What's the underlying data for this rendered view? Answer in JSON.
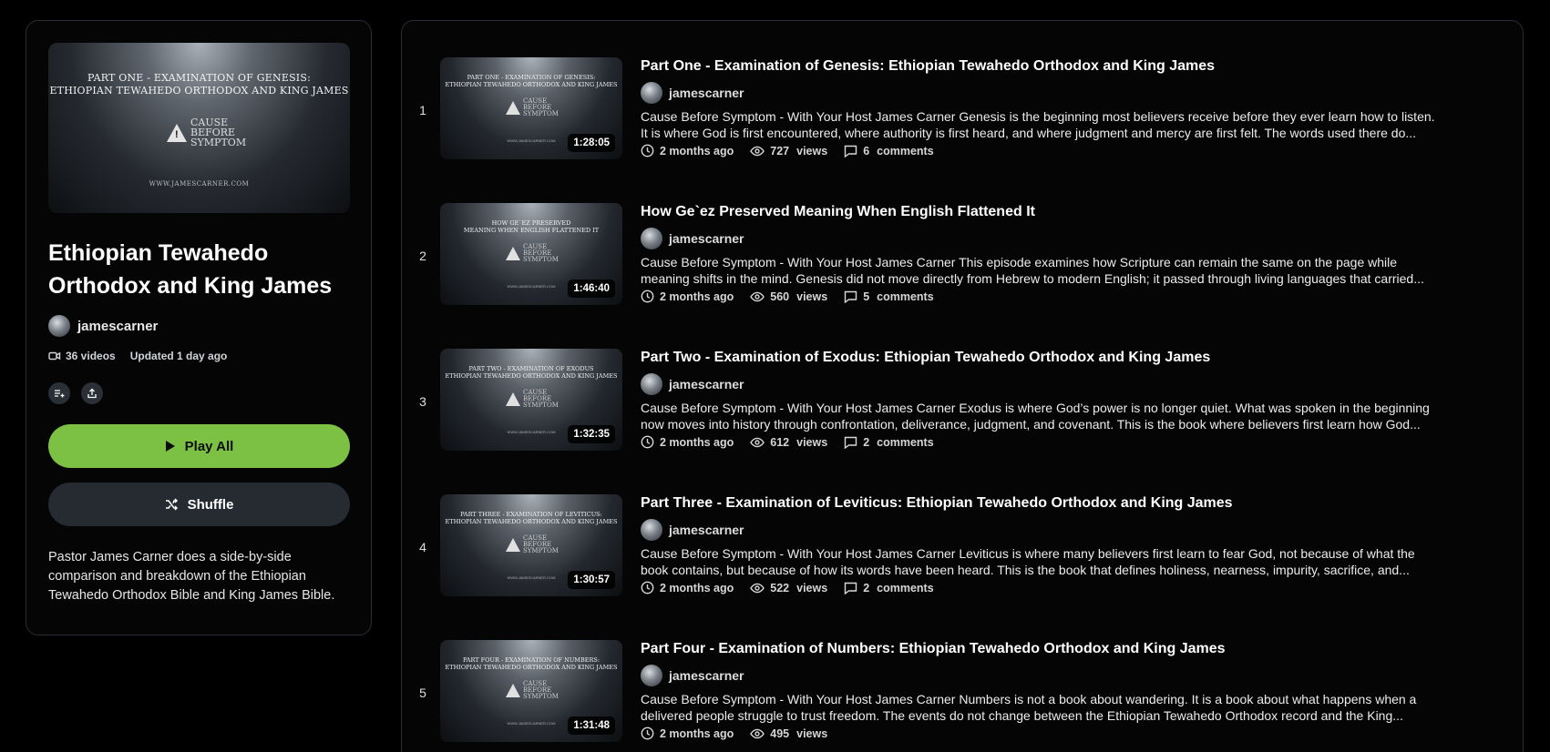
{
  "playlist": {
    "cover": {
      "line1": "PART ONE - EXAMINATION OF GENESIS:",
      "line2": "ETHIOPIAN TEWAHEDO ORTHODOX AND KING JAMES",
      "brand1": "CAUSE",
      "brand2": "BEFORE",
      "brand3": "SYMPTOM",
      "site": "WWW.JAMESCARNER.COM"
    },
    "title_line1": "Ethiopian Tewahedo",
    "title_line2": "Orthodox and King James",
    "owner": "jamescarner",
    "video_count": "36 videos",
    "updated": "Updated 1 day ago",
    "play_all": "Play All",
    "shuffle": "Shuffle",
    "description": "Pastor James Carner does a side-by-side comparison and breakdown of the Ethiopian Tewahedo Orthodox Bible and King James Bible.",
    "icons": [
      "add-to-queue-icon",
      "share-icon"
    ],
    "accent": "#7cc143"
  },
  "videos": [
    {
      "index": "1",
      "thumb_line1": "PART ONE - EXAMINATION OF GENESIS:",
      "thumb_line2": "ETHIOPIAN TEWAHEDO ORTHODOX AND KING JAMES",
      "duration": "1:28:05",
      "title": "Part One - Examination of Genesis: Ethiopian Tewahedo Orthodox and King James",
      "channel": "jamescarner",
      "desc_line1": "Cause Before Symptom - With Your Host James Carner Genesis is the beginning most believers receive before they ever learn how to listen.",
      "desc_line2": "It is where God is first encountered, where authority is first heard, and where judgment and mercy are first felt. The words used there do...",
      "age": "2 months ago",
      "views": "727",
      "views_label": "views",
      "comments": "6",
      "comments_label": "comments"
    },
    {
      "index": "2",
      "thumb_line1": "HOW GE`EZ PRESERVED",
      "thumb_line2": "MEANING WHEN ENGLISH FLATTENED IT",
      "duration": "1:46:40",
      "title": "How Ge`ez Preserved Meaning When English Flattened It",
      "channel": "jamescarner",
      "desc_line1": "Cause Before Symptom - With Your Host James Carner This episode examines how Scripture can remain the same on the page while",
      "desc_line2": "meaning shifts in the mind. Genesis did not move directly from Hebrew to modern English; it passed through living languages that carried...",
      "age": "2 months ago",
      "views": "560",
      "views_label": "views",
      "comments": "5",
      "comments_label": "comments"
    },
    {
      "index": "3",
      "thumb_line1": "PART TWO - EXAMINATION OF EXODUS",
      "thumb_line2": "ETHIOPIAN TEWAHEDO ORTHODOX AND KING JAMES",
      "duration": "1:32:35",
      "title": "Part Two - Examination of Exodus: Ethiopian Tewahedo Orthodox and King James",
      "channel": "jamescarner",
      "desc_line1": "Cause Before Symptom - With Your Host James Carner Exodus is where God’s power is no longer quiet. What was spoken in the beginning",
      "desc_line2": "now moves into history through confrontation, deliverance, judgment, and covenant. This is the book where believers first learn how God...",
      "age": "2 months ago",
      "views": "612",
      "views_label": "views",
      "comments": "2",
      "comments_label": "comments"
    },
    {
      "index": "4",
      "thumb_line1": "PART THREE - EXAMINATION OF LEVITICUS:",
      "thumb_line2": "ETHIOPIAN TEWAHEDO ORTHODOX AND KING JAMES",
      "duration": "1:30:57",
      "title": "Part Three - Examination of Leviticus: Ethiopian Tewahedo Orthodox and King James",
      "channel": "jamescarner",
      "desc_line1": "Cause Before Symptom - With Your Host James Carner Leviticus is where many believers first learn to fear God, not because of what the",
      "desc_line2": "book contains, but because of how its words have been heard. This is the book that defines holiness, nearness, impurity, sacrifice, and...",
      "age": "2 months ago",
      "views": "522",
      "views_label": "views",
      "comments": "2",
      "comments_label": "comments"
    },
    {
      "index": "5",
      "thumb_line1": "PART FOUR - EXAMINATION OF NUMBERS:",
      "thumb_line2": "ETHIOPIAN TEWAHEDO ORTHODOX AND KING JAMES",
      "duration": "1:31:48",
      "title": "Part Four - Examination of Numbers: Ethiopian Tewahedo Orthodox and King James",
      "channel": "jamescarner",
      "desc_line1": "Cause Before Symptom - With Your Host James Carner Numbers is not a book about wandering. It is a book about what happens when a",
      "desc_line2": "delivered people struggle to trust freedom. The events do not change between the Ethiopian Tewahedo Orthodox record and the King...",
      "age": "2 months ago",
      "views": "495",
      "views_label": "views",
      "comments": "",
      "comments_label": ""
    }
  ],
  "thumb_brand": [
    "CAUSE",
    "BEFORE",
    "SYMPTOM"
  ],
  "thumb_site": "WWW.JAMESCARNER.COM"
}
